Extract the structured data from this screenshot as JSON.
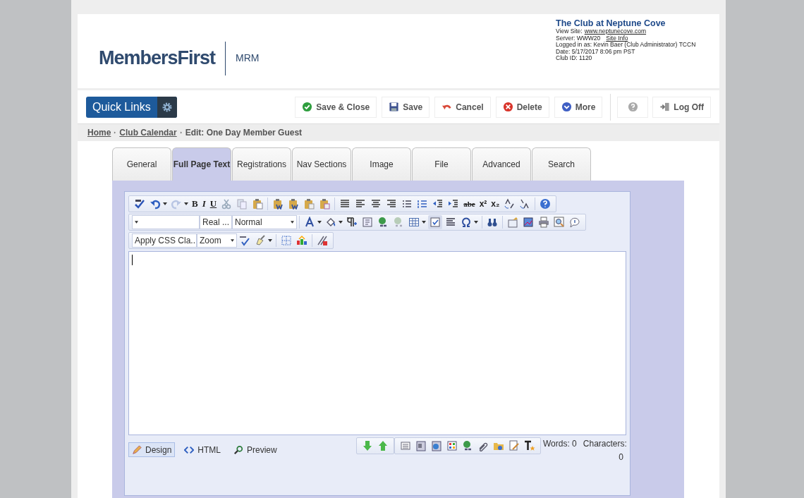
{
  "header": {
    "logo_text": "MembersFirst",
    "product": "MRM",
    "club_name": "The Club at Neptune Cove",
    "view_site_label": "View Site:",
    "view_site_link": "www.neptunecove.com",
    "server_label": "Server: WWW20",
    "site_info_link": "Site Info",
    "logged_in": "Logged in as: Kevin Baer (Club Administrator) TCCN",
    "date": "Date: 5/17/2017 8:06 pm PST",
    "club_id": "Club ID: 1120"
  },
  "quick_links": "Quick Links",
  "actions": [
    {
      "label": "Save & Close",
      "kind": "check"
    },
    {
      "label": "Save",
      "kind": "disk"
    },
    {
      "label": "Cancel",
      "kind": "undo"
    },
    {
      "label": "Delete",
      "kind": "x"
    },
    {
      "label": "More",
      "kind": "more"
    }
  ],
  "log_off": "Log Off",
  "breadcrumb": [
    {
      "label": "Home",
      "link": true
    },
    {
      "label": "Club Calendar",
      "link": true
    },
    {
      "label": "Edit: One Day Member Guest",
      "link": false
    }
  ],
  "tabs": [
    {
      "label": "General",
      "selected": false
    },
    {
      "label": "Full Page Text",
      "selected": true
    },
    {
      "label": "Registrations",
      "selected": false
    },
    {
      "label": "Nav Sections",
      "selected": false
    },
    {
      "label": "Image",
      "selected": false
    },
    {
      "label": "File",
      "selected": false
    },
    {
      "label": "Advanced",
      "selected": false
    },
    {
      "label": "Search",
      "selected": false
    }
  ],
  "editor": {
    "glyphs": [
      "B",
      "I",
      "U",
      "abe",
      "x²",
      "x₂"
    ],
    "dropdowns": [
      "Real ...",
      "Normal",
      "Apply CSS Cla..",
      "Zoom"
    ],
    "modes": [
      {
        "label": "Design",
        "selected": true
      },
      {
        "label": "HTML",
        "selected": false
      },
      {
        "label": "Preview",
        "selected": false
      }
    ],
    "words": "Words: 0",
    "characters": "Characters:",
    "characters_count": "0"
  }
}
